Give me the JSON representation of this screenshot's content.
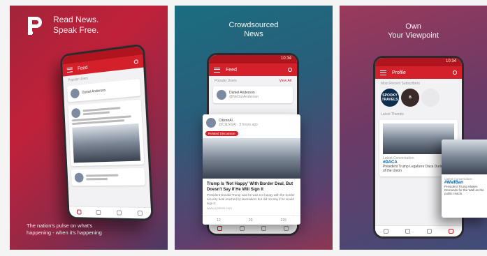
{
  "panel1": {
    "headline": [
      "Read News.",
      "Speak Free."
    ],
    "tagline": [
      "The nation's pulse on what's",
      "happening - when it's happening"
    ],
    "phone": {
      "appbar_title": "Feed",
      "section": "Popular Users",
      "user_name": "Daniel Anderson"
    }
  },
  "panel2": {
    "headline": [
      "Crowdsourced",
      "News"
    ],
    "phone": {
      "appbar_title": "Feed",
      "section": "Popular Users",
      "view_all": "View All",
      "user_name": "Daniel Anderson",
      "user_handle": "@NoDanAnderson",
      "status_time": "10:34"
    },
    "post": {
      "user": "CitizenAl",
      "handle": "@CitizenAl",
      "time": "3 hours ago",
      "tag": "Related Discussion",
      "title": "Trump Is 'Not Happy' With Border Deal, But Doesn't Say If He Will Sign It",
      "excerpt": "President Donald Trump said he was not happy with the border security deal reached by lawmakers but did not say if he would sign it.",
      "source": "www.nytimes.com",
      "counts": [
        "12",
        "20",
        "215"
      ]
    }
  },
  "panel3": {
    "headline": [
      "Own",
      "Your Viewpoint"
    ],
    "phone": {
      "appbar_title": "Profile",
      "status_time": "10:34",
      "section1": "Most Recent Subscribers",
      "section2": "Latest Thumbs",
      "badge1": "SPOOKY TRAVELS",
      "badge2": "B",
      "card_meta": "Latest Conversation",
      "hashtag": "#DACA",
      "card_text": "President Trump Legalizes Daca During State of the Union"
    },
    "side": {
      "meta": "Latest Conversation",
      "hashtag": "#WallBan",
      "text": "President Trump Makes Demands for the Wall as the public reacts"
    }
  },
  "colors": {
    "brand_red": "#d3202b",
    "status_red": "#b0141f"
  }
}
